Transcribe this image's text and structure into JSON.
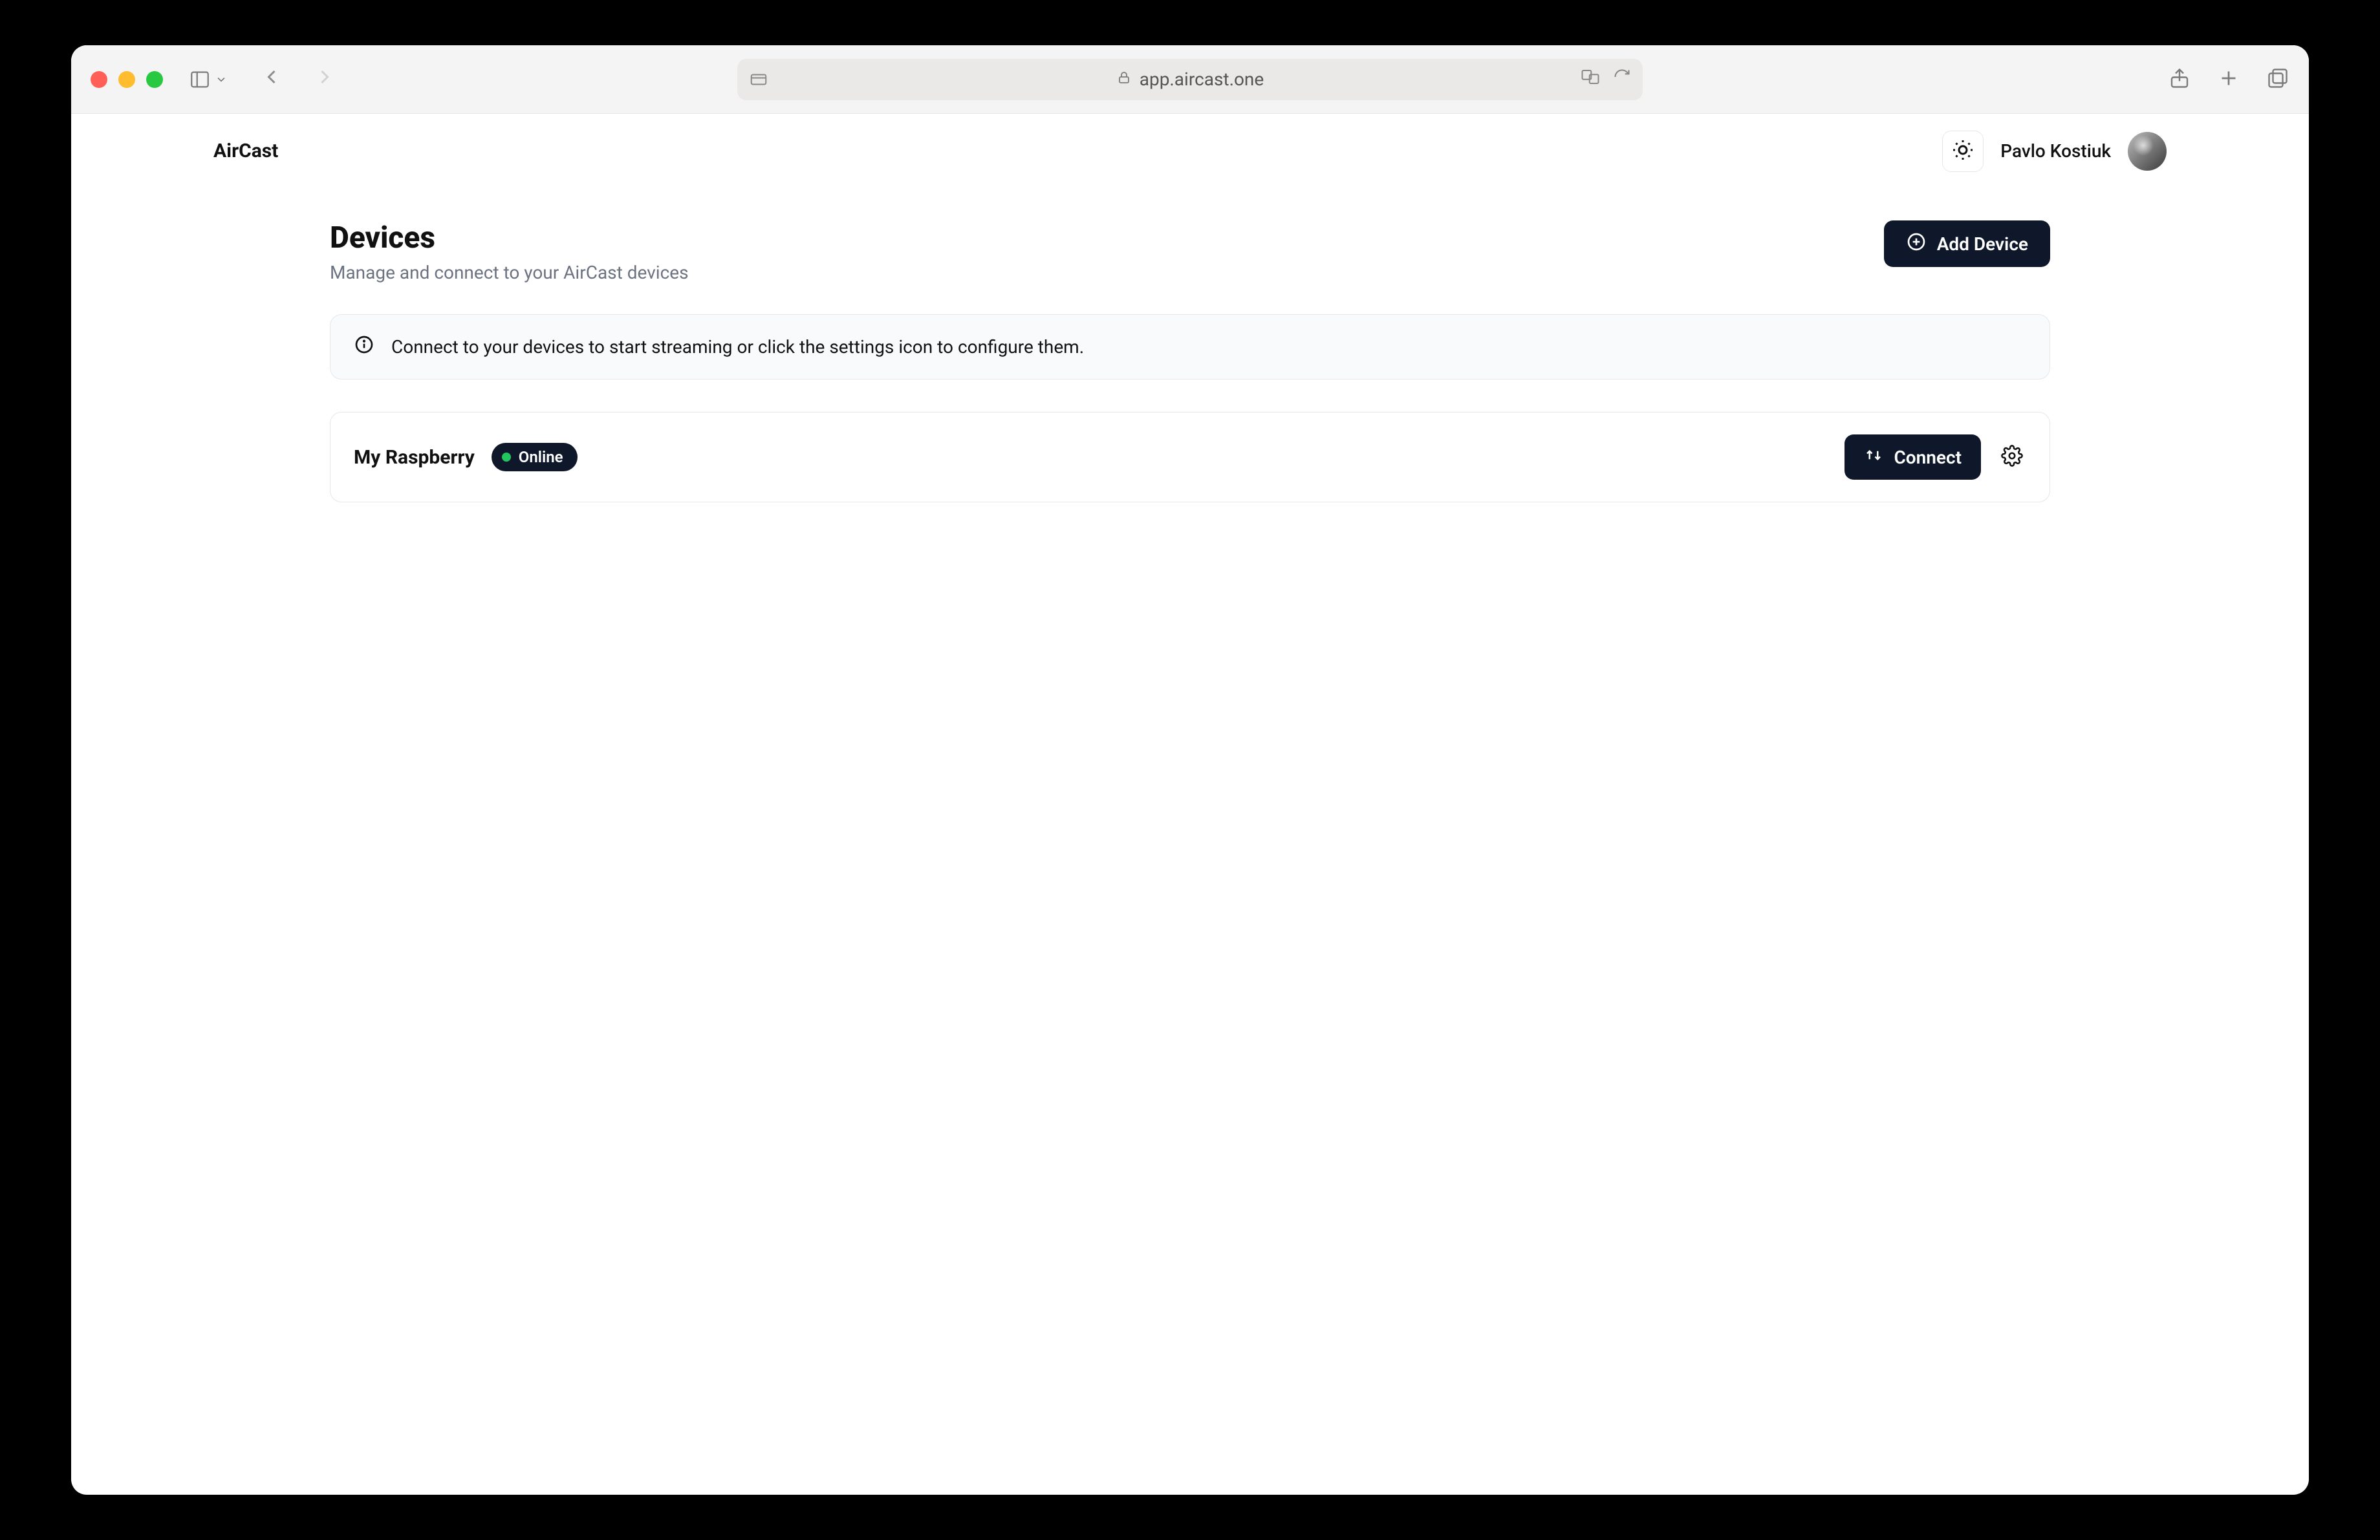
{
  "browser": {
    "url": "app.aircast.one"
  },
  "header": {
    "app_name": "AirCast",
    "user_name": "Pavlo Kostiuk"
  },
  "page": {
    "title": "Devices",
    "subtitle": "Manage and connect to your AirCast devices",
    "add_button_label": "Add Device",
    "info_banner": "Connect to your devices to start streaming or click the settings icon to configure them."
  },
  "devices": [
    {
      "name": "My Raspberry",
      "status_label": "Online",
      "status_color": "#22c55e",
      "connect_label": "Connect"
    }
  ]
}
